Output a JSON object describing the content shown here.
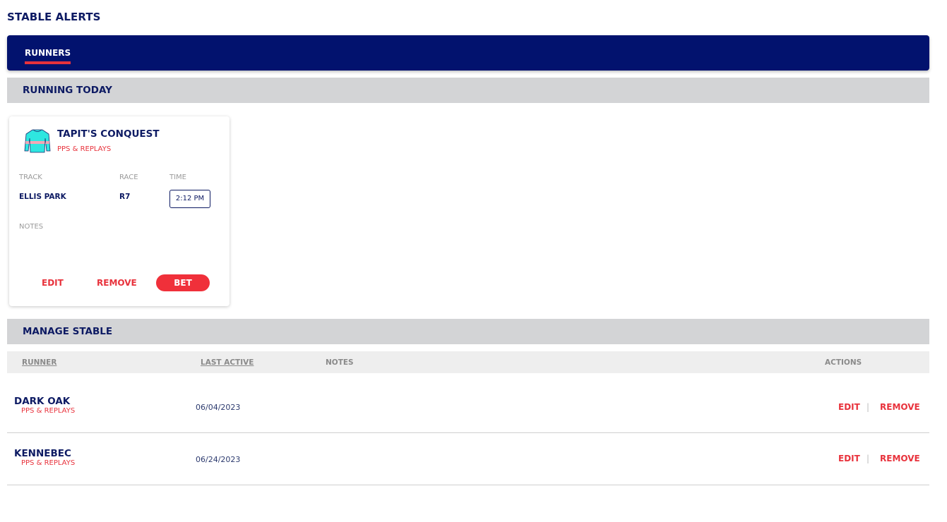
{
  "page_title": "STABLE ALERTS",
  "tabs": [
    {
      "label": "RUNNERS",
      "active": true
    }
  ],
  "running_today": {
    "heading": "RUNNING TODAY",
    "card": {
      "horse_name": "TAPIT'S CONQUEST",
      "pps_link": "PPS & REPLAYS",
      "silk_icon": "jockey-silk-icon",
      "silk_colors": {
        "primary": "#2ee6e0",
        "stripe": "#f3a7b5"
      },
      "track_label": "TRACK",
      "race_label": "RACE",
      "time_label": "TIME",
      "track": "ELLIS PARK",
      "race": "R7",
      "time": "2:12 PM",
      "notes_label": "NOTES",
      "edit_label": "EDIT",
      "remove_label": "REMOVE",
      "bet_label": "BET"
    }
  },
  "manage_stable": {
    "heading": "MANAGE STABLE",
    "columns": [
      "RUNNER",
      "LAST ACTIVE",
      "NOTES",
      "ACTIONS"
    ],
    "rows": [
      {
        "name": "DARK OAK",
        "pps_link": "PPS & REPLAYS",
        "last_active": "06/04/2023",
        "edit": "EDIT",
        "sep": "|",
        "remove": "REMOVE"
      },
      {
        "name": "KENNEBEC",
        "pps_link": "PPS & REPLAYS",
        "last_active": "06/24/2023",
        "edit": "EDIT",
        "sep": "|",
        "remove": "REMOVE"
      }
    ]
  },
  "colors": {
    "navy": "#02126e",
    "accent_red": "#e8323c",
    "section_gray": "#d3d4d6"
  }
}
